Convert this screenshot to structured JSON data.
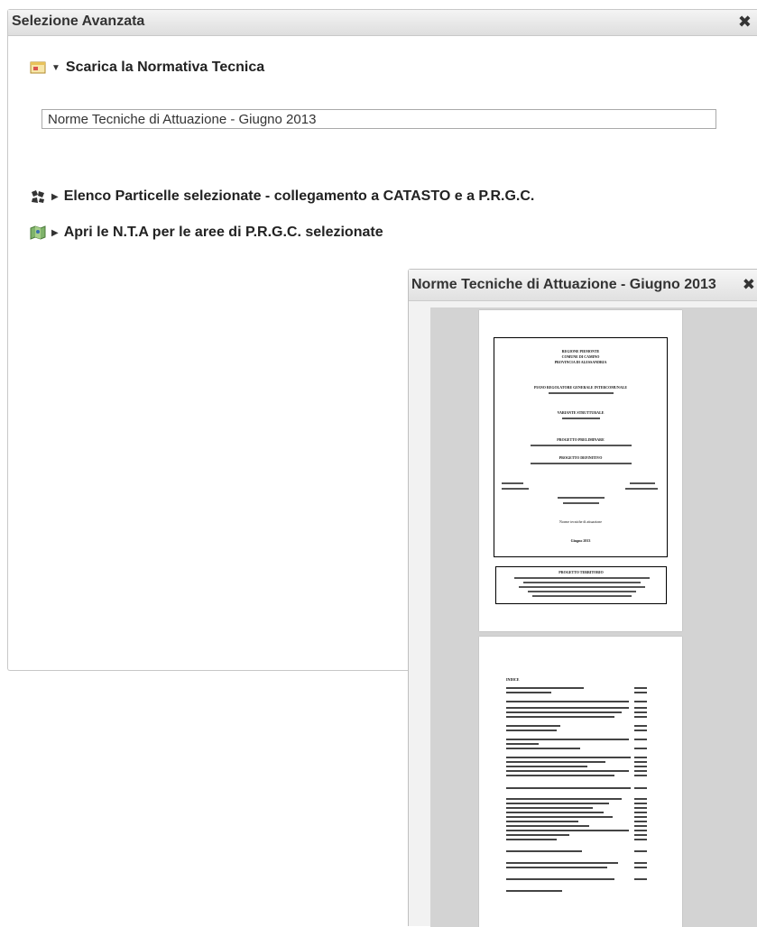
{
  "main_panel": {
    "title": "Selezione Avanzata",
    "close_glyph": "✖",
    "items": [
      {
        "label": "Scarica la Normativa Tecnica",
        "icon": "download-doc-icon",
        "state": "expanded"
      },
      {
        "label": "Elenco Particelle selezionate - collegamento a CATASTO e a P.R.G.C.",
        "icon": "parcels-icon",
        "state": "collapsed"
      },
      {
        "label": "Apri le N.T.A per le aree di P.R.G.C. selezionate",
        "icon": "map-icon",
        "state": "collapsed"
      }
    ],
    "document_link": "Norme Tecniche di Attuazione - Giugno 2013"
  },
  "pdf_window": {
    "title": "Norme Tecniche di Attuazione - Giugno 2013",
    "close_glyph": "✖",
    "page1": {
      "region": "REGIONE PIEMONTE",
      "comune": "COMUNE DI CAMINO",
      "provincia": "PROVINCIA DI ALESSANDRIA",
      "plan": "PIANO REGOLATORE GENERALE INTERCOMUNALE",
      "variante": "VARIANTE STRUTTURALE",
      "prog_prelim": "PROGETTO PRELIMINARE",
      "prog_def": "PROGETTO DEFINITIVO",
      "doc_title": "Norme tecniche di attuazione",
      "date": "Giugno 2013",
      "footer_title": "PROGETTO TERRITORIO"
    },
    "page2": {
      "heading": "INDICE"
    }
  },
  "colors": {
    "header_bg": "#e4e4e4",
    "viewer_bg": "#d3d3d3"
  }
}
